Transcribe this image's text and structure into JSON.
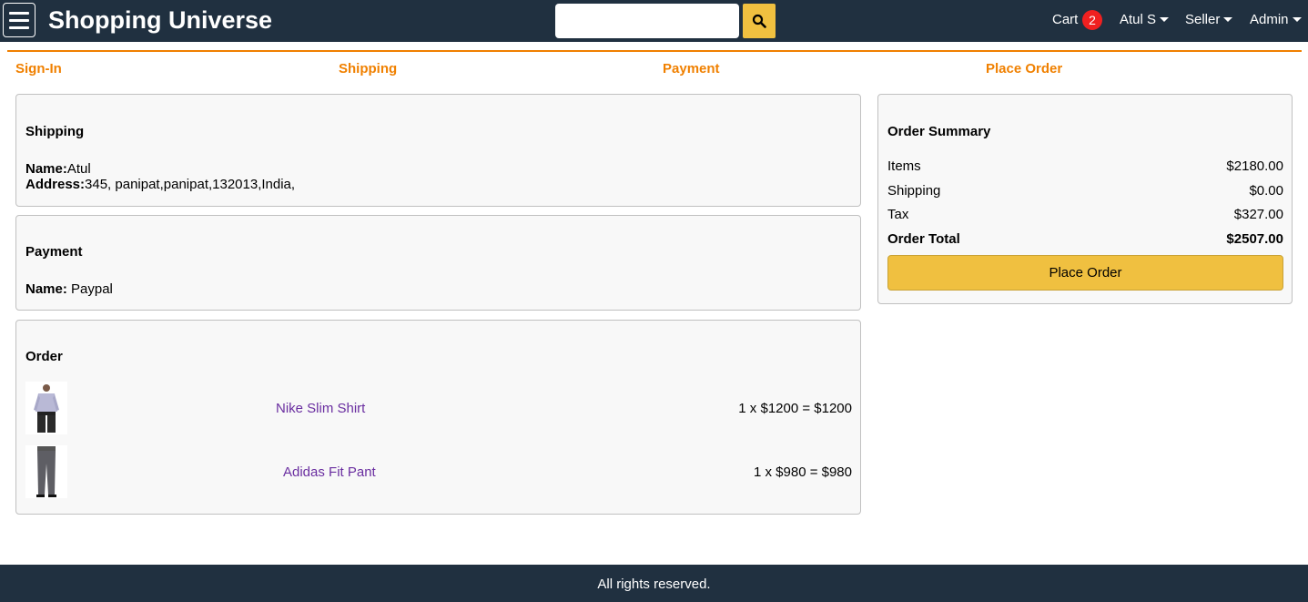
{
  "header": {
    "brand": "Shopping Universe",
    "search": {
      "value": "",
      "placeholder": ""
    },
    "cart_label": "Cart",
    "cart_count": "2",
    "user_menu": "Atul S",
    "seller_menu": "Seller",
    "admin_menu": "Admin"
  },
  "steps": [
    "Sign-In",
    "Shipping",
    "Payment",
    "Place Order"
  ],
  "shipping": {
    "title": "Shipping",
    "name_label": "Name:",
    "name": "Atul",
    "address_label": "Address:",
    "address": "345, panipat,panipat,132013,India,"
  },
  "payment": {
    "title": "Payment",
    "name_label": "Name:",
    "method": " Paypal"
  },
  "order": {
    "title": "Order",
    "items": [
      {
        "name": "Nike Slim Shirt",
        "price_line": "1 x $1200 = $1200"
      },
      {
        "name": "Adidas Fit Pant",
        "price_line": "1 x $980 = $980"
      }
    ]
  },
  "summary": {
    "title": "Order Summary",
    "rows": [
      {
        "label": "Items",
        "value": "$2180.00"
      },
      {
        "label": "Shipping",
        "value": "$0.00"
      },
      {
        "label": "Tax",
        "value": "$327.00"
      }
    ],
    "total_label": "Order Total",
    "total_value": "$2507.00",
    "button": "Place Order"
  },
  "footer": {
    "text": "All rights reserved."
  },
  "colors": {
    "header_bg": "#203040",
    "accent": "#f0c040",
    "step_active": "#f08000",
    "link": "#6a2ea0",
    "badge": "#f02020"
  }
}
